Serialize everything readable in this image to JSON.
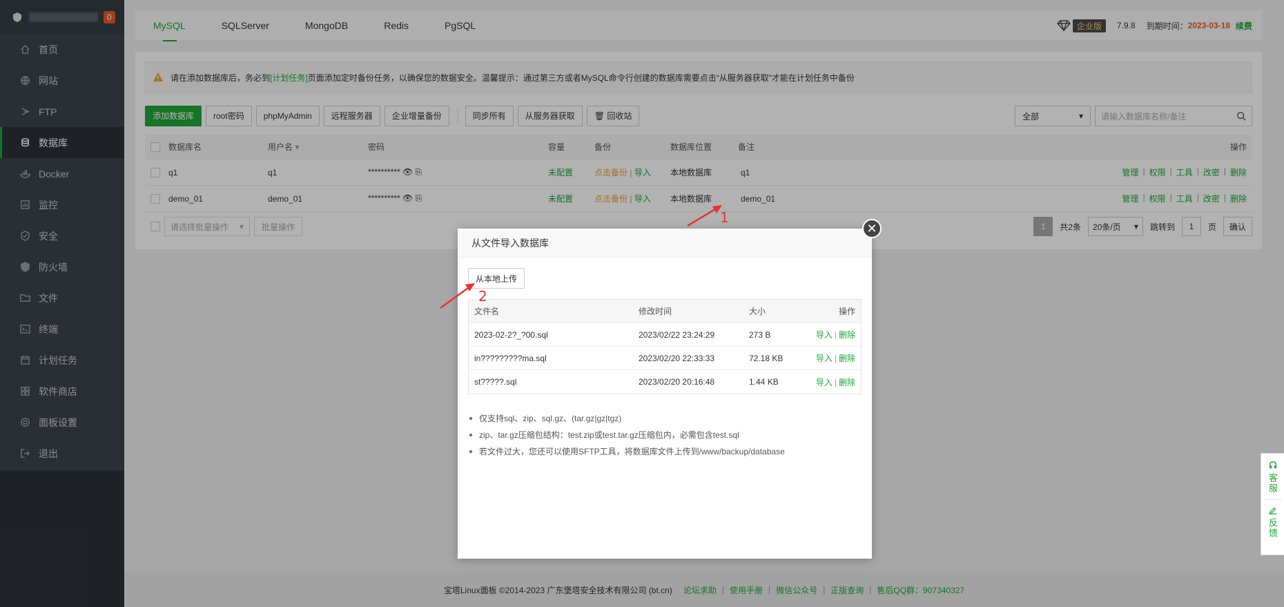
{
  "sidebar": {
    "badge": "0",
    "items": [
      {
        "label": "首页",
        "icon": "home-icon"
      },
      {
        "label": "网站",
        "icon": "globe-icon"
      },
      {
        "label": "FTP",
        "icon": "ftp-icon"
      },
      {
        "label": "数据库",
        "icon": "database-icon"
      },
      {
        "label": "Docker",
        "icon": "docker-icon"
      },
      {
        "label": "监控",
        "icon": "monitor-icon"
      },
      {
        "label": "安全",
        "icon": "shield-icon"
      },
      {
        "label": "防火墙",
        "icon": "firewall-icon"
      },
      {
        "label": "文件",
        "icon": "folder-icon"
      },
      {
        "label": "终端",
        "icon": "terminal-icon"
      },
      {
        "label": "计划任务",
        "icon": "calendar-icon"
      },
      {
        "label": "软件商店",
        "icon": "grid-icon"
      },
      {
        "label": "面板设置",
        "icon": "gear-icon"
      },
      {
        "label": "退出",
        "icon": "logout-icon"
      }
    ]
  },
  "tabs": [
    "MySQL",
    "SQLServer",
    "MongoDB",
    "Redis",
    "PgSQL"
  ],
  "header_right": {
    "edition": "企业版",
    "version": "7.9.8",
    "expire_label": "到期时间：",
    "expire_date": "2023-03-18",
    "renew": "续费"
  },
  "notice": {
    "part1": "请在添加数据库后，务必到",
    "link": "[计划任务]",
    "part2": "页面添加定时备份任务，以确保您的数据安全。温馨提示：通过第三方或者MySQL命令行创建的数据库需要点击“从服务器获取”才能在计划任务中备份"
  },
  "toolbar": {
    "add": "添加数据库",
    "root_pwd": "root密码",
    "phpmyadmin": "phpMyAdmin",
    "remote": "远程服务器",
    "inc_backup": "企业增量备份",
    "sync_all": "同步所有",
    "fetch": "从服务器获取",
    "recycle": "回收站",
    "filter": "全部",
    "search_placeholder": "请输入数据库名称/备注"
  },
  "table": {
    "headers": {
      "name": "数据库名",
      "user": "用户名",
      "password": "密码",
      "capacity": "容量",
      "backup": "备份",
      "location": "数据库位置",
      "note": "备注",
      "ops": "操作"
    },
    "rows": [
      {
        "name": "q1",
        "user": "q1",
        "password": "**********",
        "capacity": "未配置",
        "backup": "点击备份",
        "import": "导入",
        "location": "本地数据库",
        "note": "q1"
      },
      {
        "name": "demo_01",
        "user": "demo_01",
        "password": "**********",
        "capacity": "未配置",
        "backup": "点击备份",
        "import": "导入",
        "location": "本地数据库",
        "note": "demo_01"
      }
    ],
    "ops": [
      "管理",
      "权限",
      "工具",
      "改密",
      "删除"
    ]
  },
  "batch": {
    "select": "请选择批量操作",
    "button": "批量操作"
  },
  "pager": {
    "page": "1",
    "total": "共2条",
    "size": "20条/页",
    "goto": "跳转到",
    "goto_val": "1",
    "page_unit": "页",
    "confirm": "确认"
  },
  "footer": {
    "copyright": "宝塔Linux面板 ©2014-2023 广东堡塔安全技术有限公司 (bt.cn)",
    "links": [
      "论坛求助",
      "使用手册",
      "微信公众号",
      "正版查询"
    ],
    "qq": "售后QQ群：907340327"
  },
  "modal": {
    "title": "从文件导入数据库",
    "upload": "从本地上传",
    "headers": {
      "name": "文件名",
      "mtime": "修改时间",
      "size": "大小",
      "ops": "操作"
    },
    "files": [
      {
        "name": "2023-02-2?_?00.sql",
        "mtime": "2023/02/22 23:24:29",
        "size": "273 B"
      },
      {
        "name": "in?????????ma.sql",
        "mtime": "2023/02/20 22:33:33",
        "size": "72.18 KB"
      },
      {
        "name": "st?????.sql",
        "mtime": "2023/02/20 20:16:48",
        "size": "1.44 KB"
      }
    ],
    "op_import": "导入",
    "op_delete": "删除",
    "tips": [
      "仅支持sql、zip、sql.gz、(tar.gz|gz|tgz)",
      "zip、tar.gz压缩包结构：test.zip或test.tar.gz压缩包内，必需包含test.sql",
      "若文件过大，您还可以使用SFTP工具，将数据库文件上传到/www/backup/database"
    ]
  },
  "annotations": [
    "1",
    "2"
  ],
  "side_float": {
    "service": "客服",
    "feedback": "反馈"
  }
}
